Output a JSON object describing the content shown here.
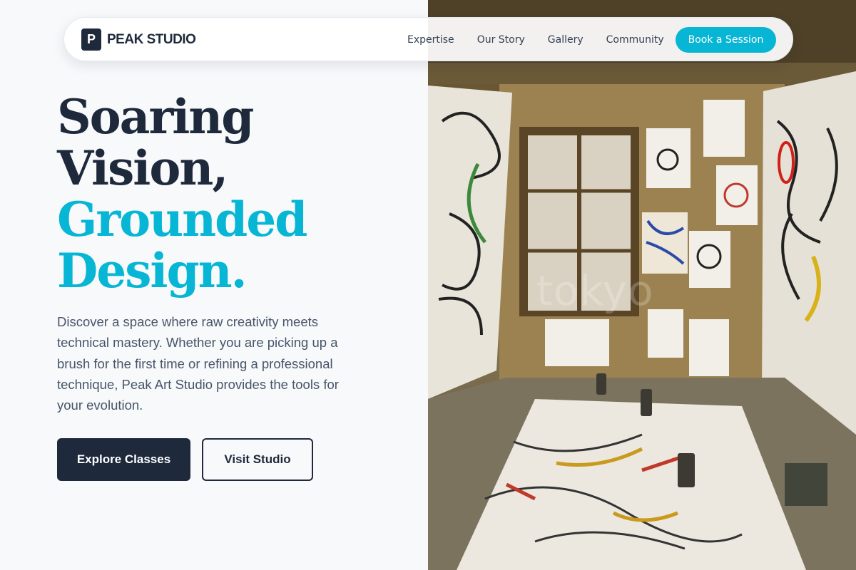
{
  "brand": {
    "mark": "P",
    "name": "PEAK STUDIO"
  },
  "nav": {
    "links": [
      "Expertise",
      "Our Story",
      "Gallery",
      "Community"
    ],
    "cta": "Book a Session"
  },
  "hero": {
    "headline": [
      "Soaring",
      "Vision,",
      "Grounded",
      "Design."
    ],
    "intro": "Discover a space where raw creativity meets technical mastery. Whether you are picking up a brush for the first time or refining a professional technique, Peak Art Studio provides the tools for your evolution.",
    "primary_button": "Explore Classes",
    "secondary_button": "Visit Studio",
    "image_watermark": "tokyo"
  },
  "colors": {
    "primary_dark": "#1e293b",
    "accent": "#06b6d4",
    "background": "#f7f9fb",
    "body_text": "#475569"
  }
}
